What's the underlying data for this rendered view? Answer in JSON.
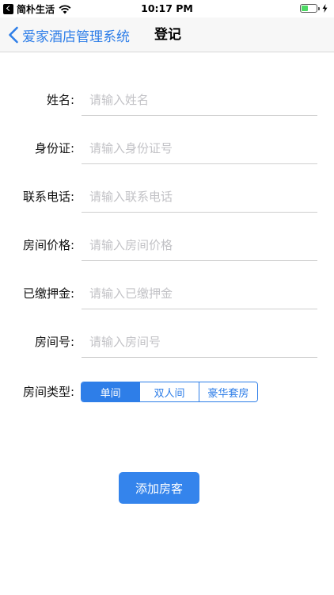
{
  "status_bar": {
    "carrier": "简朴生活",
    "time": "10:17 PM",
    "battery_level": 0.45
  },
  "nav": {
    "back_label": "爱家酒店管理系统",
    "title": "登记"
  },
  "form": {
    "fields": [
      {
        "label": "姓名:",
        "placeholder": "请输入姓名",
        "value": ""
      },
      {
        "label": "身份证:",
        "placeholder": "请输入身份证号",
        "value": ""
      },
      {
        "label": "联系电话:",
        "placeholder": "请输入联系电话",
        "value": ""
      },
      {
        "label": "房间价格:",
        "placeholder": "请输入房间价格",
        "value": ""
      },
      {
        "label": "已缴押金:",
        "placeholder": "请输入已缴押金",
        "value": ""
      },
      {
        "label": "房间号:",
        "placeholder": "请输入房间号",
        "value": ""
      }
    ],
    "room_type": {
      "label": "房间类型:",
      "options": [
        "单间",
        "双人间",
        "豪华套房"
      ],
      "selected_index": 0
    },
    "submit_label": "添加房客"
  },
  "colors": {
    "accent": "#2e7ee8",
    "button": "#3484ec",
    "placeholder": "#c2c2c6",
    "battery": "#4cd964"
  },
  "icons": {
    "status_back": "back-badge-icon",
    "wifi": "wifi-icon",
    "battery": "battery-icon",
    "charging": "charging-bolt-icon",
    "nav_back": "chevron-left-icon"
  }
}
